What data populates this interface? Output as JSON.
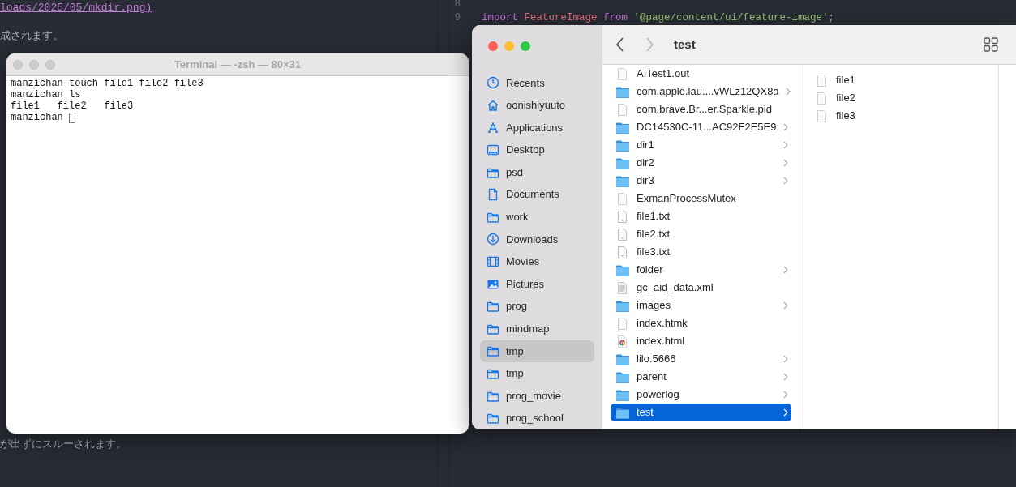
{
  "editor_left": {
    "lines": [
      {
        "text": "loads/2025/05/mkdir.png)",
        "kind": "link"
      },
      {
        "text": "成されます。",
        "kind": "text"
      },
      {
        "text": "が出ずにスルーされます。",
        "kind": "text"
      }
    ]
  },
  "editor_right": {
    "lines": [
      {
        "number": "8"
      },
      {
        "number": "9",
        "tokens": [
          {
            "text": "import",
            "kind": "keyword"
          },
          {
            "text": "FeatureImage",
            "kind": "identifier"
          },
          {
            "text": "from",
            "kind": "keyword"
          },
          {
            "text": "'@page/content/ui/feature-image'",
            "kind": "string"
          },
          {
            "text": ";",
            "kind": "punct"
          }
        ]
      }
    ]
  },
  "terminal": {
    "title": "Terminal — -zsh — 80×31",
    "active": false,
    "lines": [
      {
        "text": "manzichan touch file1 file2 file3",
        "cursor": false
      },
      {
        "text": "manzichan ls",
        "cursor": false
      },
      {
        "text": "file1   file2   file3",
        "cursor": false
      },
      {
        "text": "manzichan",
        "cursor": true
      }
    ]
  },
  "finder": {
    "title": "test",
    "back_enabled": true,
    "forward_enabled": false,
    "sidebar": [
      {
        "label": "Recents",
        "kind": "recents",
        "selected": false
      },
      {
        "label": "oonishiyuuto",
        "kind": "home",
        "selected": false
      },
      {
        "label": "Applications",
        "kind": "applications",
        "selected": false
      },
      {
        "label": "Desktop",
        "kind": "desktop",
        "selected": false
      },
      {
        "label": "psd",
        "kind": "folder",
        "selected": false
      },
      {
        "label": "Documents",
        "kind": "document",
        "selected": false
      },
      {
        "label": "work",
        "kind": "folder",
        "selected": false
      },
      {
        "label": "Downloads",
        "kind": "downloads",
        "selected": false
      },
      {
        "label": "Movies",
        "kind": "movies",
        "selected": false
      },
      {
        "label": "Pictures",
        "kind": "pictures",
        "selected": false
      },
      {
        "label": "prog",
        "kind": "folder",
        "selected": false
      },
      {
        "label": "mindmap",
        "kind": "folder",
        "selected": false
      },
      {
        "label": "tmp",
        "kind": "folder",
        "selected": true
      },
      {
        "label": "tmp",
        "kind": "folder",
        "selected": false
      },
      {
        "label": "prog_movie",
        "kind": "folder",
        "selected": false
      },
      {
        "label": "prog_school",
        "kind": "folder",
        "selected": false
      }
    ],
    "columns": [
      [
        {
          "name": "AITest1.out",
          "kind": "file",
          "selected": false
        },
        {
          "name": "com.apple.lau....vWLz12QX8a",
          "kind": "folder",
          "selected": false
        },
        {
          "name": "com.brave.Br...er.Sparkle.pid",
          "kind": "file",
          "selected": false
        },
        {
          "name": "DC14530C-11...AC92F2E5E9",
          "kind": "folder",
          "selected": false
        },
        {
          "name": "dir1",
          "kind": "folder",
          "selected": false
        },
        {
          "name": "dir2",
          "kind": "folder",
          "selected": false
        },
        {
          "name": "dir3",
          "kind": "folder",
          "selected": false
        },
        {
          "name": "ExmanProcessMutex",
          "kind": "file",
          "selected": false
        },
        {
          "name": "file1.txt",
          "kind": "text",
          "selected": false
        },
        {
          "name": "file2.txt",
          "kind": "text",
          "selected": false
        },
        {
          "name": "file3.txt",
          "kind": "text",
          "selected": false
        },
        {
          "name": "folder",
          "kind": "folder",
          "selected": false
        },
        {
          "name": "gc_aid_data.xml",
          "kind": "xml",
          "selected": false
        },
        {
          "name": "images",
          "kind": "folder",
          "selected": false
        },
        {
          "name": "index.htmk",
          "kind": "file",
          "selected": false
        },
        {
          "name": "index.html",
          "kind": "browser",
          "selected": false
        },
        {
          "name": "lilo.5666",
          "kind": "folder",
          "selected": false
        },
        {
          "name": "parent",
          "kind": "folder",
          "selected": false
        },
        {
          "name": "powerlog",
          "kind": "folder",
          "selected": false
        },
        {
          "name": "test",
          "kind": "folder",
          "selected": true
        }
      ],
      [
        {
          "name": "file1",
          "kind": "file",
          "selected": false
        },
        {
          "name": "file2",
          "kind": "file",
          "selected": false
        },
        {
          "name": "file3",
          "kind": "file",
          "selected": false
        }
      ]
    ]
  }
}
